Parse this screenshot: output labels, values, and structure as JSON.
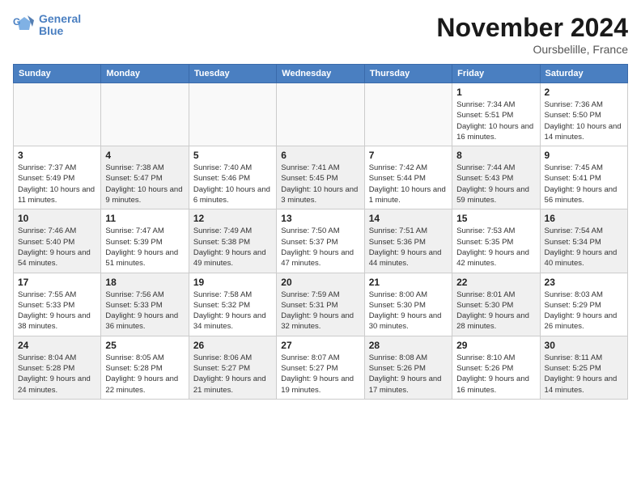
{
  "header": {
    "logo_text1": "General",
    "logo_text2": "Blue",
    "month_title": "November 2024",
    "location": "Oursbelille, France"
  },
  "days_of_week": [
    "Sunday",
    "Monday",
    "Tuesday",
    "Wednesday",
    "Thursday",
    "Friday",
    "Saturday"
  ],
  "weeks": [
    [
      {
        "day": "",
        "info": ""
      },
      {
        "day": "",
        "info": ""
      },
      {
        "day": "",
        "info": ""
      },
      {
        "day": "",
        "info": ""
      },
      {
        "day": "",
        "info": ""
      },
      {
        "day": "1",
        "info": "Sunrise: 7:34 AM\nSunset: 5:51 PM\nDaylight: 10 hours and 16 minutes."
      },
      {
        "day": "2",
        "info": "Sunrise: 7:36 AM\nSunset: 5:50 PM\nDaylight: 10 hours and 14 minutes."
      }
    ],
    [
      {
        "day": "3",
        "info": "Sunrise: 7:37 AM\nSunset: 5:49 PM\nDaylight: 10 hours and 11 minutes."
      },
      {
        "day": "4",
        "info": "Sunrise: 7:38 AM\nSunset: 5:47 PM\nDaylight: 10 hours and 9 minutes."
      },
      {
        "day": "5",
        "info": "Sunrise: 7:40 AM\nSunset: 5:46 PM\nDaylight: 10 hours and 6 minutes."
      },
      {
        "day": "6",
        "info": "Sunrise: 7:41 AM\nSunset: 5:45 PM\nDaylight: 10 hours and 3 minutes."
      },
      {
        "day": "7",
        "info": "Sunrise: 7:42 AM\nSunset: 5:44 PM\nDaylight: 10 hours and 1 minute."
      },
      {
        "day": "8",
        "info": "Sunrise: 7:44 AM\nSunset: 5:43 PM\nDaylight: 9 hours and 59 minutes."
      },
      {
        "day": "9",
        "info": "Sunrise: 7:45 AM\nSunset: 5:41 PM\nDaylight: 9 hours and 56 minutes."
      }
    ],
    [
      {
        "day": "10",
        "info": "Sunrise: 7:46 AM\nSunset: 5:40 PM\nDaylight: 9 hours and 54 minutes."
      },
      {
        "day": "11",
        "info": "Sunrise: 7:47 AM\nSunset: 5:39 PM\nDaylight: 9 hours and 51 minutes."
      },
      {
        "day": "12",
        "info": "Sunrise: 7:49 AM\nSunset: 5:38 PM\nDaylight: 9 hours and 49 minutes."
      },
      {
        "day": "13",
        "info": "Sunrise: 7:50 AM\nSunset: 5:37 PM\nDaylight: 9 hours and 47 minutes."
      },
      {
        "day": "14",
        "info": "Sunrise: 7:51 AM\nSunset: 5:36 PM\nDaylight: 9 hours and 44 minutes."
      },
      {
        "day": "15",
        "info": "Sunrise: 7:53 AM\nSunset: 5:35 PM\nDaylight: 9 hours and 42 minutes."
      },
      {
        "day": "16",
        "info": "Sunrise: 7:54 AM\nSunset: 5:34 PM\nDaylight: 9 hours and 40 minutes."
      }
    ],
    [
      {
        "day": "17",
        "info": "Sunrise: 7:55 AM\nSunset: 5:33 PM\nDaylight: 9 hours and 38 minutes."
      },
      {
        "day": "18",
        "info": "Sunrise: 7:56 AM\nSunset: 5:33 PM\nDaylight: 9 hours and 36 minutes."
      },
      {
        "day": "19",
        "info": "Sunrise: 7:58 AM\nSunset: 5:32 PM\nDaylight: 9 hours and 34 minutes."
      },
      {
        "day": "20",
        "info": "Sunrise: 7:59 AM\nSunset: 5:31 PM\nDaylight: 9 hours and 32 minutes."
      },
      {
        "day": "21",
        "info": "Sunrise: 8:00 AM\nSunset: 5:30 PM\nDaylight: 9 hours and 30 minutes."
      },
      {
        "day": "22",
        "info": "Sunrise: 8:01 AM\nSunset: 5:30 PM\nDaylight: 9 hours and 28 minutes."
      },
      {
        "day": "23",
        "info": "Sunrise: 8:03 AM\nSunset: 5:29 PM\nDaylight: 9 hours and 26 minutes."
      }
    ],
    [
      {
        "day": "24",
        "info": "Sunrise: 8:04 AM\nSunset: 5:28 PM\nDaylight: 9 hours and 24 minutes."
      },
      {
        "day": "25",
        "info": "Sunrise: 8:05 AM\nSunset: 5:28 PM\nDaylight: 9 hours and 22 minutes."
      },
      {
        "day": "26",
        "info": "Sunrise: 8:06 AM\nSunset: 5:27 PM\nDaylight: 9 hours and 21 minutes."
      },
      {
        "day": "27",
        "info": "Sunrise: 8:07 AM\nSunset: 5:27 PM\nDaylight: 9 hours and 19 minutes."
      },
      {
        "day": "28",
        "info": "Sunrise: 8:08 AM\nSunset: 5:26 PM\nDaylight: 9 hours and 17 minutes."
      },
      {
        "day": "29",
        "info": "Sunrise: 8:10 AM\nSunset: 5:26 PM\nDaylight: 9 hours and 16 minutes."
      },
      {
        "day": "30",
        "info": "Sunrise: 8:11 AM\nSunset: 5:25 PM\nDaylight: 9 hours and 14 minutes."
      }
    ]
  ]
}
